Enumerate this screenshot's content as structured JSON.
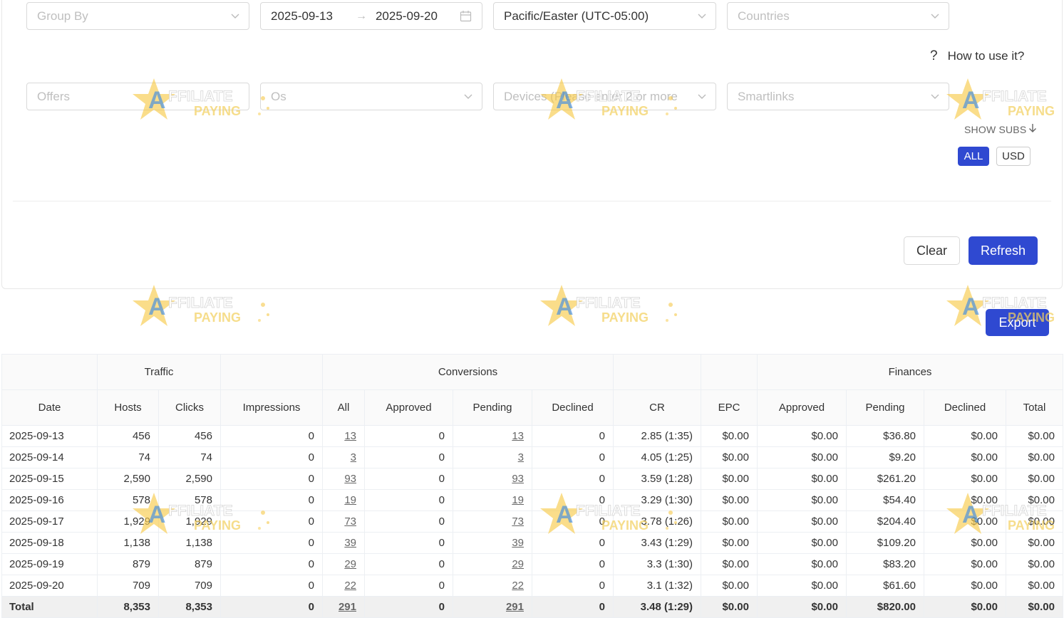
{
  "filters": {
    "group_by_placeholder": "Group By",
    "date_start": "2025-09-13",
    "date_arrow": "→",
    "date_end": "2025-09-20",
    "timezone": "Pacific/Easter (UTC-05:00)",
    "countries_placeholder": "Countries",
    "offers_placeholder": "Offers",
    "os_placeholder": "Os",
    "devices_placeholder": "Devices (Please enter 2 or more",
    "smartlinks_placeholder": "Smartlinks"
  },
  "help": {
    "icon": "?",
    "label": "How to use it?"
  },
  "show_subs": "SHOW SUBS",
  "currency": {
    "all": "ALL",
    "usd": "USD"
  },
  "actions": {
    "clear": "Clear",
    "refresh": "Refresh",
    "export": "Export"
  },
  "watermark": {
    "line1": "AFFILIATE",
    "line2": "PAYING"
  },
  "table": {
    "groups": {
      "traffic": "Traffic",
      "conversions": "Conversions",
      "finances": "Finances"
    },
    "columns": [
      "Date",
      "Hosts",
      "Clicks",
      "Impressions",
      "All",
      "Approved",
      "Pending",
      "Declined",
      "CR",
      "EPC",
      "Approved",
      "Pending",
      "Declined",
      "Total"
    ],
    "rows": [
      [
        "2025-09-13",
        "456",
        "456",
        "0",
        "13",
        "0",
        "13",
        "0",
        "2.85 (1:35)",
        "$0.00",
        "$0.00",
        "$36.80",
        "$0.00",
        "$0.00"
      ],
      [
        "2025-09-14",
        "74",
        "74",
        "0",
        "3",
        "0",
        "3",
        "0",
        "4.05 (1:25)",
        "$0.00",
        "$0.00",
        "$9.20",
        "$0.00",
        "$0.00"
      ],
      [
        "2025-09-15",
        "2,590",
        "2,590",
        "0",
        "93",
        "0",
        "93",
        "0",
        "3.59 (1:28)",
        "$0.00",
        "$0.00",
        "$261.20",
        "$0.00",
        "$0.00"
      ],
      [
        "2025-09-16",
        "578",
        "578",
        "0",
        "19",
        "0",
        "19",
        "0",
        "3.29 (1:30)",
        "$0.00",
        "$0.00",
        "$54.40",
        "$0.00",
        "$0.00"
      ],
      [
        "2025-09-17",
        "1,929",
        "1,929",
        "0",
        "73",
        "0",
        "73",
        "0",
        "3.78 (1:26)",
        "$0.00",
        "$0.00",
        "$204.40",
        "$0.00",
        "$0.00"
      ],
      [
        "2025-09-18",
        "1,138",
        "1,138",
        "0",
        "39",
        "0",
        "39",
        "0",
        "3.43 (1:29)",
        "$0.00",
        "$0.00",
        "$109.20",
        "$0.00",
        "$0.00"
      ],
      [
        "2025-09-19",
        "879",
        "879",
        "0",
        "29",
        "0",
        "29",
        "0",
        "3.3 (1:30)",
        "$0.00",
        "$0.00",
        "$83.20",
        "$0.00",
        "$0.00"
      ],
      [
        "2025-09-20",
        "709",
        "709",
        "0",
        "22",
        "0",
        "22",
        "0",
        "3.1 (1:32)",
        "$0.00",
        "$0.00",
        "$61.60",
        "$0.00",
        "$0.00"
      ]
    ],
    "total": [
      "Total",
      "8,353",
      "8,353",
      "0",
      "291",
      "0",
      "291",
      "0",
      "3.48 (1:29)",
      "$0.00",
      "$0.00",
      "$820.00",
      "$0.00",
      "$0.00"
    ]
  }
}
